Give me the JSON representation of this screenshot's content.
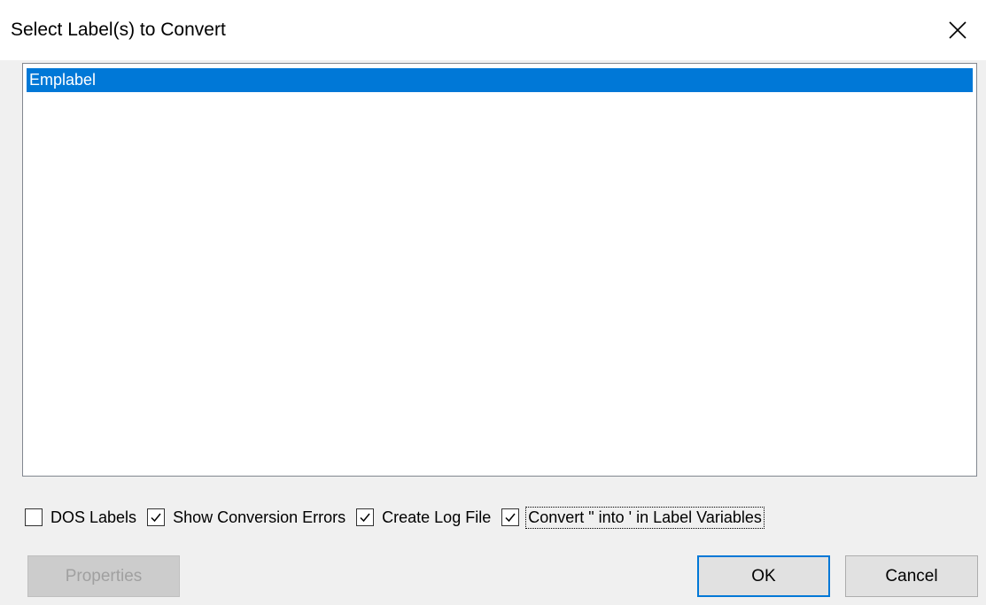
{
  "window": {
    "title": "Select Label(s) to Convert",
    "close_icon": "close-icon"
  },
  "list": {
    "items": [
      {
        "label": "Emplabel",
        "selected": true
      }
    ]
  },
  "options": [
    {
      "label": "DOS Labels",
      "checked": false
    },
    {
      "label": "Show Conversion Errors",
      "checked": true
    },
    {
      "label": "Create Log File",
      "checked": true
    },
    {
      "label": "Convert \" into ' in Label Variables",
      "checked": true,
      "focused": true
    }
  ],
  "buttons": {
    "properties": {
      "label": "Properties",
      "enabled": false
    },
    "ok": {
      "label": "OK",
      "default": true
    },
    "cancel": {
      "label": "Cancel"
    }
  },
  "colors": {
    "selection": "#0078d7",
    "default_button_border": "#0078d7",
    "dialog_bg": "#f0f0f0"
  }
}
